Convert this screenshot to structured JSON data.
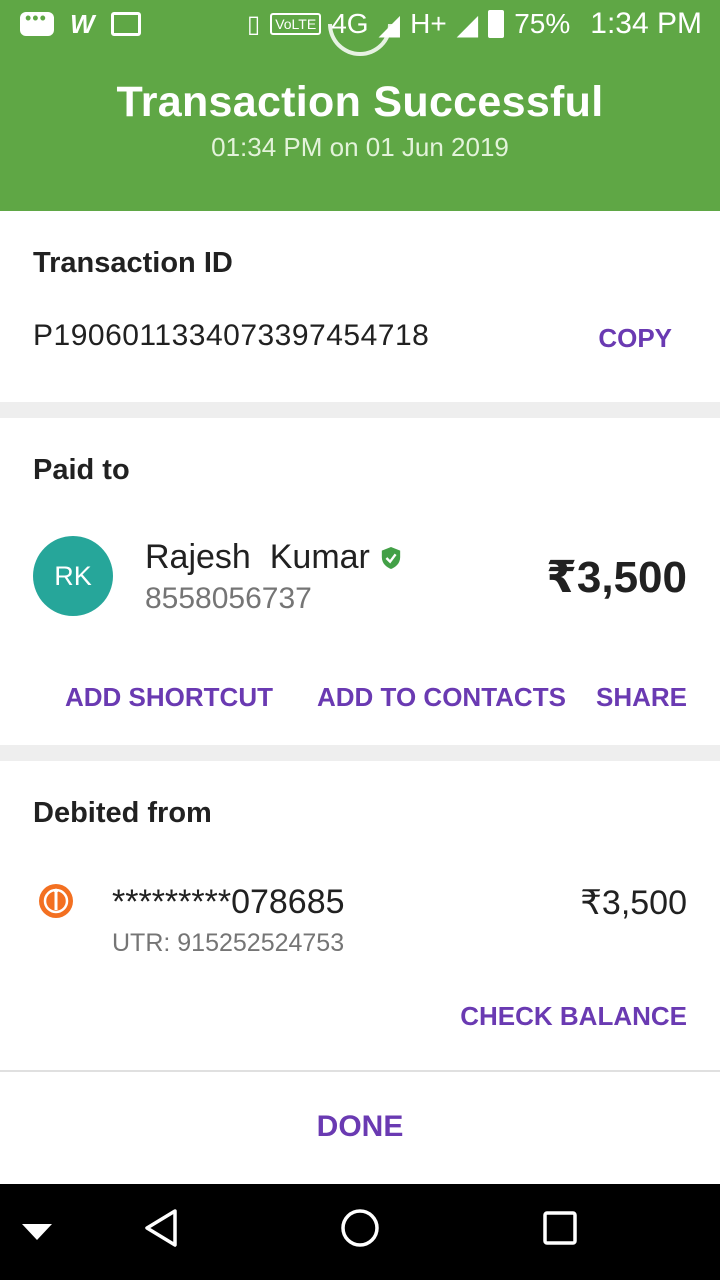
{
  "status_bar": {
    "network_label": "VoLTE",
    "signal_4g": "4G",
    "signal_h": "H+",
    "battery": "75%",
    "time": "1:34 PM"
  },
  "header": {
    "title": "Transaction Successful",
    "subtitle": "01:34 PM on 01 Jun 2019",
    "color": "#5fa745"
  },
  "transaction": {
    "label": "Transaction ID",
    "id": "P1906011334073397454718",
    "copy_label": "COPY"
  },
  "paid_to": {
    "label": "Paid to",
    "initials": "RK",
    "name": "Rajesh  Kumar",
    "phone": "8558056737",
    "amount": "₹3,500",
    "actions": {
      "add_shortcut": "ADD SHORTCUT",
      "add_to_contacts": "ADD TO CONTACTS",
      "share": "SHARE"
    }
  },
  "debited_from": {
    "label": "Debited from",
    "account": "*********078685",
    "utr": "UTR: 915252524753",
    "amount": "₹3,500",
    "check_balance": "CHECK BALANCE"
  },
  "done_label": "DONE",
  "accent_color": "#6a3ab2",
  "icons": [
    "chat-icon",
    "mail-icon",
    "vibrate-icon",
    "battery-icon",
    "verified-icon",
    "bank-logo-icon",
    "back-icon",
    "home-icon",
    "recents-icon"
  ]
}
